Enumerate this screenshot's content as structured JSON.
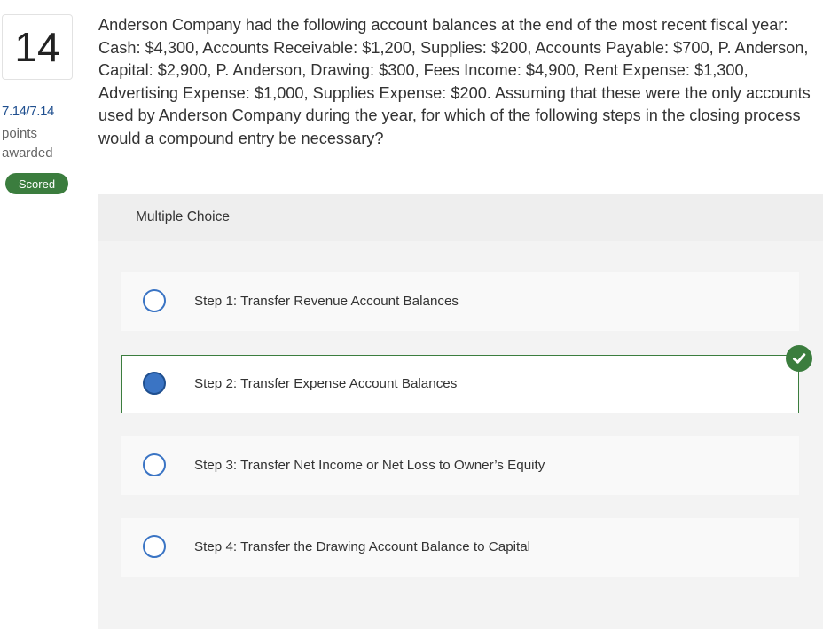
{
  "question": {
    "number": "14",
    "score": "7.14/7.14",
    "points_label": "points",
    "awarded_label": "awarded",
    "status_badge": "Scored",
    "text": "Anderson Company had the following account balances at the end of the most recent fiscal year: Cash: $4,300, Accounts Receivable: $1,200, Supplies: $200, Accounts Payable: $700, P. Anderson, Capital: $2,900, P. Anderson, Drawing: $300, Fees Income: $4,900, Rent Expense: $1,300, Advertising Expense: $1,000, Supplies Expense: $200. Assuming that these were the only accounts used by Anderson Company during the year, for which of the following steps in the closing process would a compound entry be necessary?"
  },
  "multiple_choice": {
    "label": "Multiple Choice",
    "options": [
      {
        "label": "Step 1: Transfer Revenue Account Balances",
        "selected": false
      },
      {
        "label": "Step 2: Transfer Expense Account Balances",
        "selected": true,
        "correct": true
      },
      {
        "label": "Step 3: Transfer Net Income or Net Loss to Owner’s Equity",
        "selected": false
      },
      {
        "label": "Step 4: Transfer the Drawing Account Balance to Capital",
        "selected": false
      }
    ]
  },
  "colors": {
    "correct_green": "#3b7d3e",
    "radio_blue": "#3a74c4",
    "score_blue": "#1f4f8f"
  },
  "icons": {
    "correct": "check-circle-icon"
  }
}
